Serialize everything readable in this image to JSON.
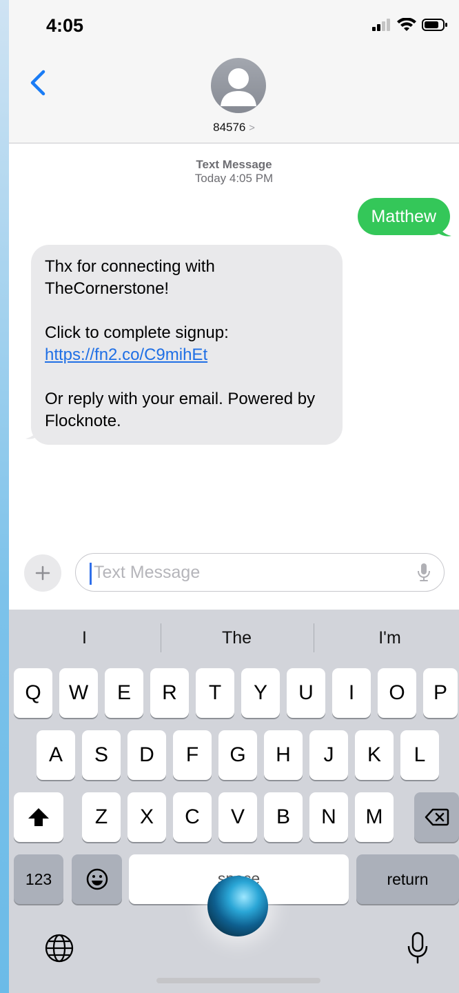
{
  "status_bar": {
    "time": "4:05"
  },
  "header": {
    "contact_number": "84576",
    "contact_chevron": ">"
  },
  "thread": {
    "meta_line1": "Text Message",
    "meta_line2": "Today 4:05 PM",
    "outgoing": [
      {
        "text": "Matthew"
      }
    ],
    "incoming": {
      "line1": "Thx for connecting with TheCornerstone!",
      "line2_prefix": "Click to complete signup: ",
      "link": "https://fn2.co/C9mihEt",
      "line3": " Or reply with your email. Powered by Flocknote."
    }
  },
  "composer": {
    "placeholder": "Text Message",
    "plus": "+"
  },
  "keyboard": {
    "suggestions": [
      "I",
      "The",
      "I'm"
    ],
    "row1": [
      "Q",
      "W",
      "E",
      "R",
      "T",
      "Y",
      "U",
      "I",
      "O",
      "P"
    ],
    "row2": [
      "A",
      "S",
      "D",
      "F",
      "G",
      "H",
      "J",
      "K",
      "L"
    ],
    "row3": [
      "Z",
      "X",
      "C",
      "V",
      "B",
      "N",
      "M"
    ],
    "numbers_key": "123",
    "space_key": "space",
    "return_key": "return"
  },
  "colors": {
    "outgoing_bubble": "#34c759",
    "incoming_bubble": "#e9e9eb",
    "link": "#1f6fe5",
    "accent": "#1a7cf5"
  },
  "icons": [
    "back-chevron-icon",
    "avatar-icon",
    "plus-icon",
    "microphone-icon",
    "shift-icon",
    "delete-icon",
    "emoji-icon",
    "globe-icon",
    "dictation-icon",
    "siri-icon",
    "signal-icon",
    "wifi-icon",
    "battery-icon"
  ]
}
